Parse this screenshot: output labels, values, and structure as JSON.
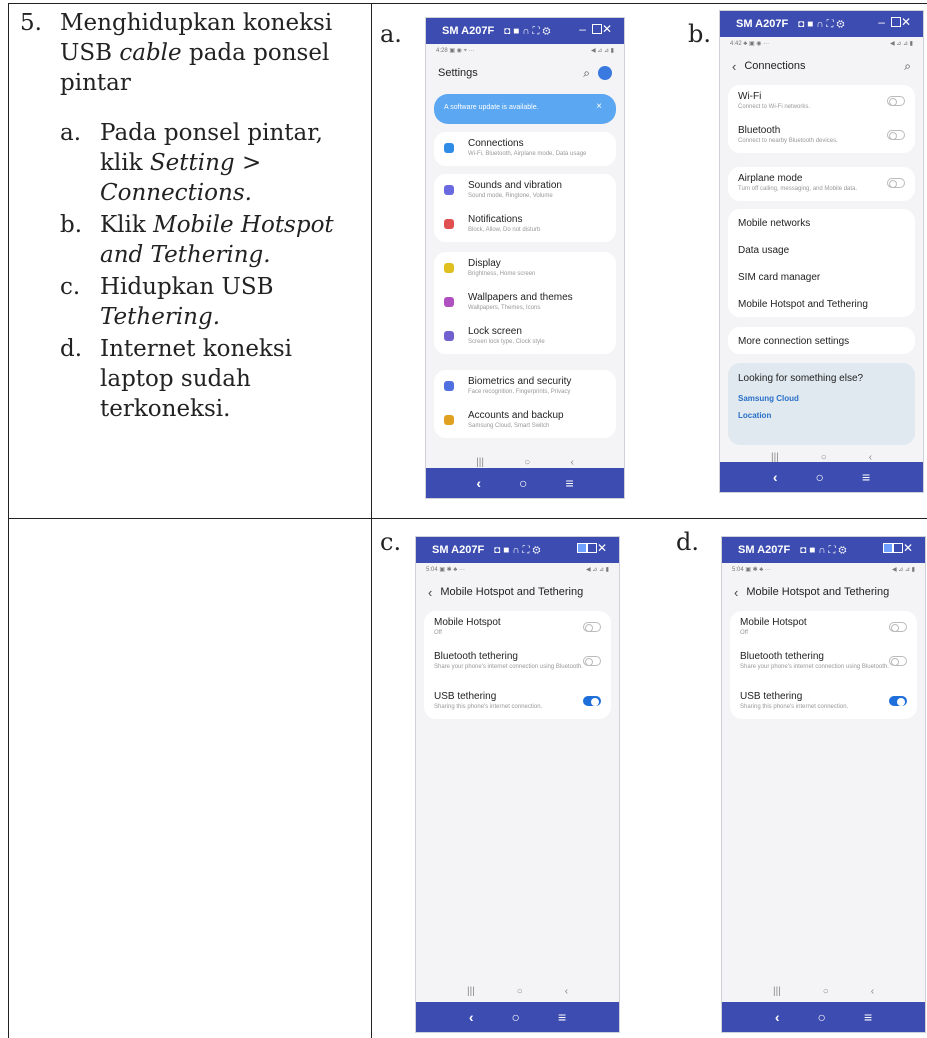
{
  "step": {
    "number": "5.",
    "title": "Menghidupkan koneksi USB cable pada ponsel pintar",
    "title_pre": "Menghidupkan koneksi USB ",
    "title_it": "cable",
    "title_post": " pada ponsel pintar",
    "items": [
      {
        "letter": "a.",
        "text": "Pada ponsel pintar, klik ",
        "it": "Setting > Connections."
      },
      {
        "letter": "b.",
        "text": "Klik ",
        "it": "Mobile Hotspot and Tethering."
      },
      {
        "letter": "c.",
        "text": "Hidupkan USB ",
        "it": "Tethering."
      },
      {
        "letter": "d.",
        "text": "Internet koneksi laptop sudah terkoneksi.",
        "it": ""
      }
    ]
  },
  "panel_letters": {
    "a": "a.",
    "b": "b.",
    "c": "c.",
    "d": "d."
  },
  "window": {
    "device": "SM A207F",
    "icons": [
      "camera-icon",
      "video-icon",
      "headset-icon",
      "expand-icon",
      "gear-icon"
    ],
    "controls": [
      "minimize",
      "maximize",
      "close"
    ]
  },
  "phone_a": {
    "status_left": "4:28 ▣ ◉ ⌖ ···",
    "status_right": "◀ ⊿ ⊿ ▮",
    "title": "Settings",
    "banner": "A software update is available.",
    "groups": [
      [
        {
          "title": "Connections",
          "sub": "Wi-Fi, Bluetooth, Airplane mode, Data usage",
          "icon_color": "#2e8be6"
        }
      ],
      [
        {
          "title": "Sounds and vibration",
          "sub": "Sound mode, Ringtone, Volume",
          "icon_color": "#6a6ae0"
        },
        {
          "title": "Notifications",
          "sub": "Block, Allow, Do not disturb",
          "icon_color": "#e05050"
        }
      ],
      [
        {
          "title": "Display",
          "sub": "Brightness, Home screen",
          "icon_color": "#e0c020"
        },
        {
          "title": "Wallpapers and themes",
          "sub": "Wallpapers, Themes, Icons",
          "icon_color": "#b050c0"
        },
        {
          "title": "Lock screen",
          "sub": "Screen lock type, Clock style",
          "icon_color": "#7060d0"
        }
      ],
      [
        {
          "title": "Biometrics and security",
          "sub": "Face recognition, Fingerprints, Privacy",
          "icon_color": "#5070e0"
        },
        {
          "title": "Accounts and backup",
          "sub": "Samsung Cloud, Smart Switch",
          "icon_color": "#e0a020"
        }
      ]
    ]
  },
  "phone_b": {
    "status_left": "4:42 ♣ ▣ ◉ ···",
    "status_right": "◀ ⊿ ⊿ ▮",
    "title": "Connections",
    "toggles": [
      {
        "title": "Wi-Fi",
        "sub": "Connect to Wi-Fi networks."
      },
      {
        "title": "Bluetooth",
        "sub": "Connect to nearby Bluetooth devices."
      },
      {
        "title": "Airplane mode",
        "sub": "Turn off calling, messaging, and Mobile data."
      }
    ],
    "links": [
      "Mobile networks",
      "Data usage",
      "SIM card manager",
      "Mobile Hotspot and Tethering"
    ],
    "more": "More connection settings",
    "suggest_title": "Looking for something else?",
    "suggest_links": [
      "Samsung Cloud",
      "Location"
    ]
  },
  "phone_c": {
    "status_left": "5:04 ▣ ✱ ♣ ···",
    "status_right": "◀ ⊿ ⊿ ▮",
    "title": "Mobile Hotspot and Tethering",
    "rows": [
      {
        "title": "Mobile Hotspot",
        "sub": "Off",
        "on": false
      },
      {
        "title": "Bluetooth tethering",
        "sub": "Share your phone's internet connection using Bluetooth.",
        "on": false
      },
      {
        "title": "USB tethering",
        "sub": "Sharing this phone's internet connection.",
        "on": true
      }
    ]
  },
  "phone_d": {
    "status_left": "5:04 ▣ ✱ ♣ ···",
    "status_right": "◀ ⊿ ⊿ ▮",
    "title": "Mobile Hotspot and Tethering",
    "rows": [
      {
        "title": "Mobile Hotspot",
        "sub": "Off",
        "on": false
      },
      {
        "title": "Bluetooth tethering",
        "sub": "Share your phone's internet connection using Bluetooth.",
        "on": false
      },
      {
        "title": "USB tethering",
        "sub": "Sharing this phone's internet connection.",
        "on": true
      }
    ]
  },
  "softkeys": [
    "|||",
    "○",
    "‹"
  ],
  "navkeys": [
    "‹",
    "○",
    "≡"
  ]
}
